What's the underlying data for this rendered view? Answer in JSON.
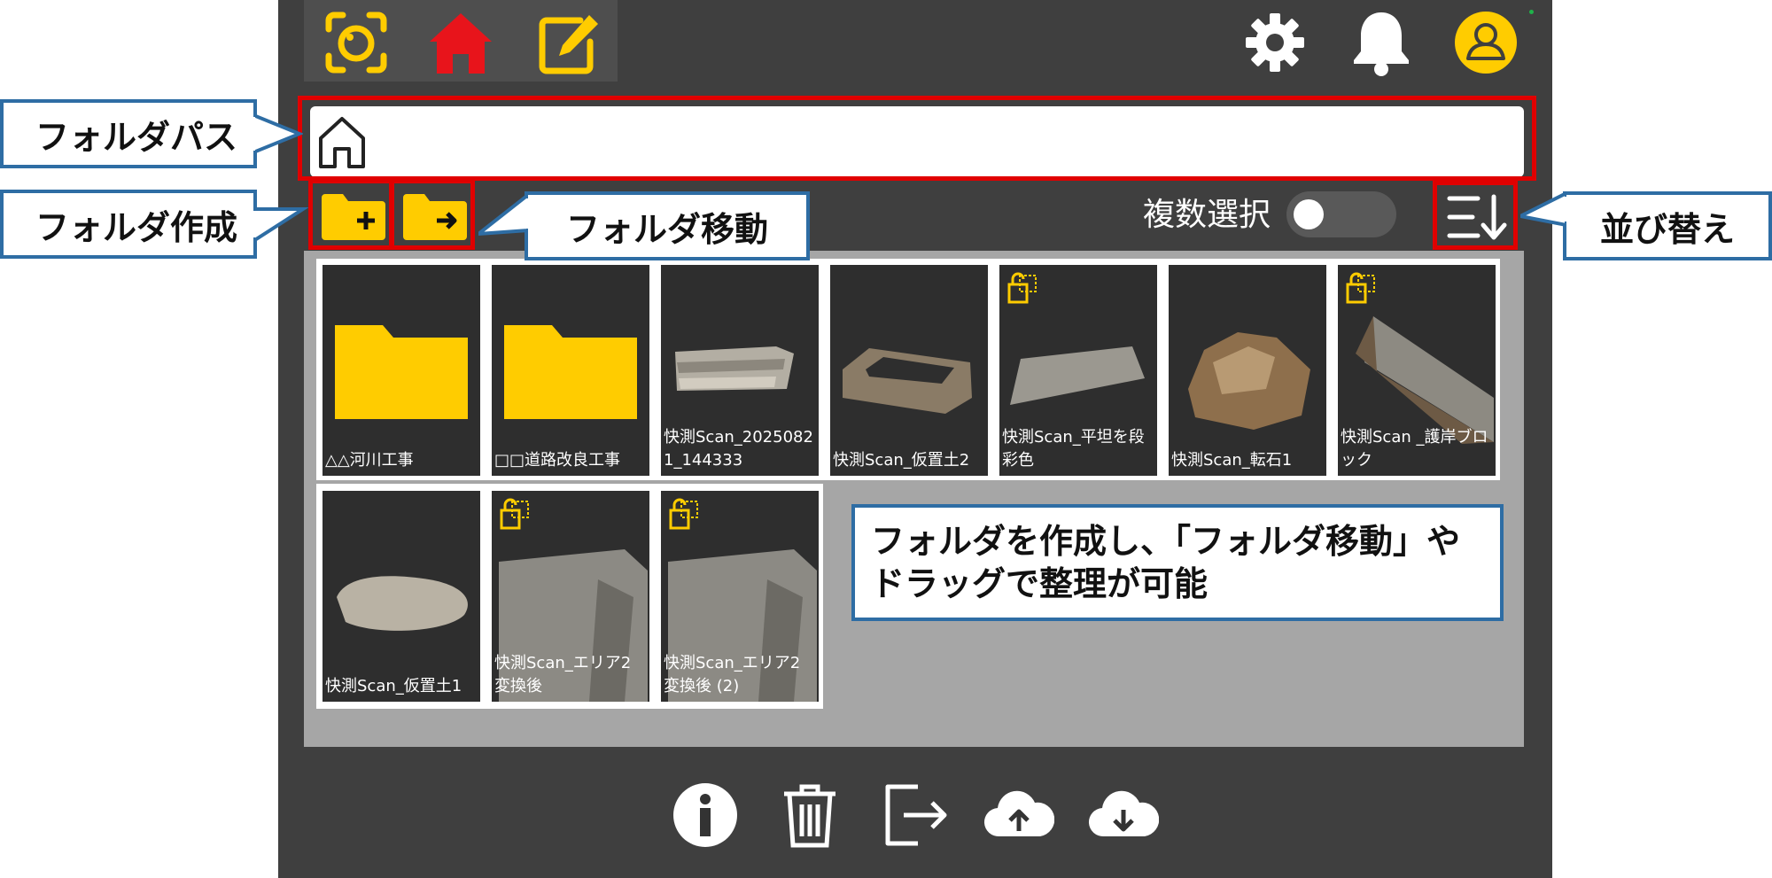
{
  "colors": {
    "accent_yellow": "#ffcc00",
    "home_red": "#e8141b",
    "annotation_red": "#e00000",
    "callout_blue": "#2e6da4",
    "app_bg": "#3f3f3f",
    "content_bg": "#a6a6a6",
    "tile_bg": "#2e2e2e"
  },
  "nav": {
    "items": [
      {
        "icon": "scan-icon"
      },
      {
        "icon": "home-icon",
        "active": true
      },
      {
        "icon": "edit-icon"
      }
    ]
  },
  "header_right": {
    "icons": [
      "gear-icon",
      "bell-icon",
      "user-icon"
    ]
  },
  "path_bar": {
    "icon": "home-outline-icon",
    "path": ""
  },
  "toolbar": {
    "new_folder_icon": "folder-plus-icon",
    "move_folder_icon": "folder-arrow-icon",
    "multi_select_label": "複数選択",
    "multi_select_on": false,
    "sort_icon": "sort-icon"
  },
  "tiles": [
    {
      "type": "folder",
      "label": "△△河川工事"
    },
    {
      "type": "folder",
      "label": "□□道路改良工事"
    },
    {
      "type": "scan",
      "label": "快測Scan_20250821_144333",
      "locked": false
    },
    {
      "type": "scan",
      "label": "快測Scan_仮置土2",
      "locked": false
    },
    {
      "type": "scan",
      "label": "快測Scan_平坦を段彩色",
      "locked": true
    },
    {
      "type": "scan",
      "label": "快測Scan_転石1",
      "locked": false
    },
    {
      "type": "scan",
      "label": "快測Scan _護岸ブロック",
      "locked": true
    },
    {
      "type": "scan",
      "label": "快測Scan_仮置土1",
      "locked": false
    },
    {
      "type": "scan",
      "label": "快測Scan_エリア2変換後",
      "locked": true
    },
    {
      "type": "scan",
      "label": "快測Scan_エリア2変換後 (2)",
      "locked": true
    }
  ],
  "annotations": {
    "folder_path": "フォルダパス",
    "create_folder": "フォルダ作成",
    "move_folder": "フォルダ移動",
    "sort": "並び替え",
    "note_line1": "フォルダを作成し、「フォルダ移動」や",
    "note_line2": "ドラッグで整理が可能"
  },
  "bottom_bar": {
    "icons": [
      "info-icon",
      "trash-icon",
      "export-icon",
      "upload-cloud-icon",
      "download-cloud-icon"
    ]
  }
}
